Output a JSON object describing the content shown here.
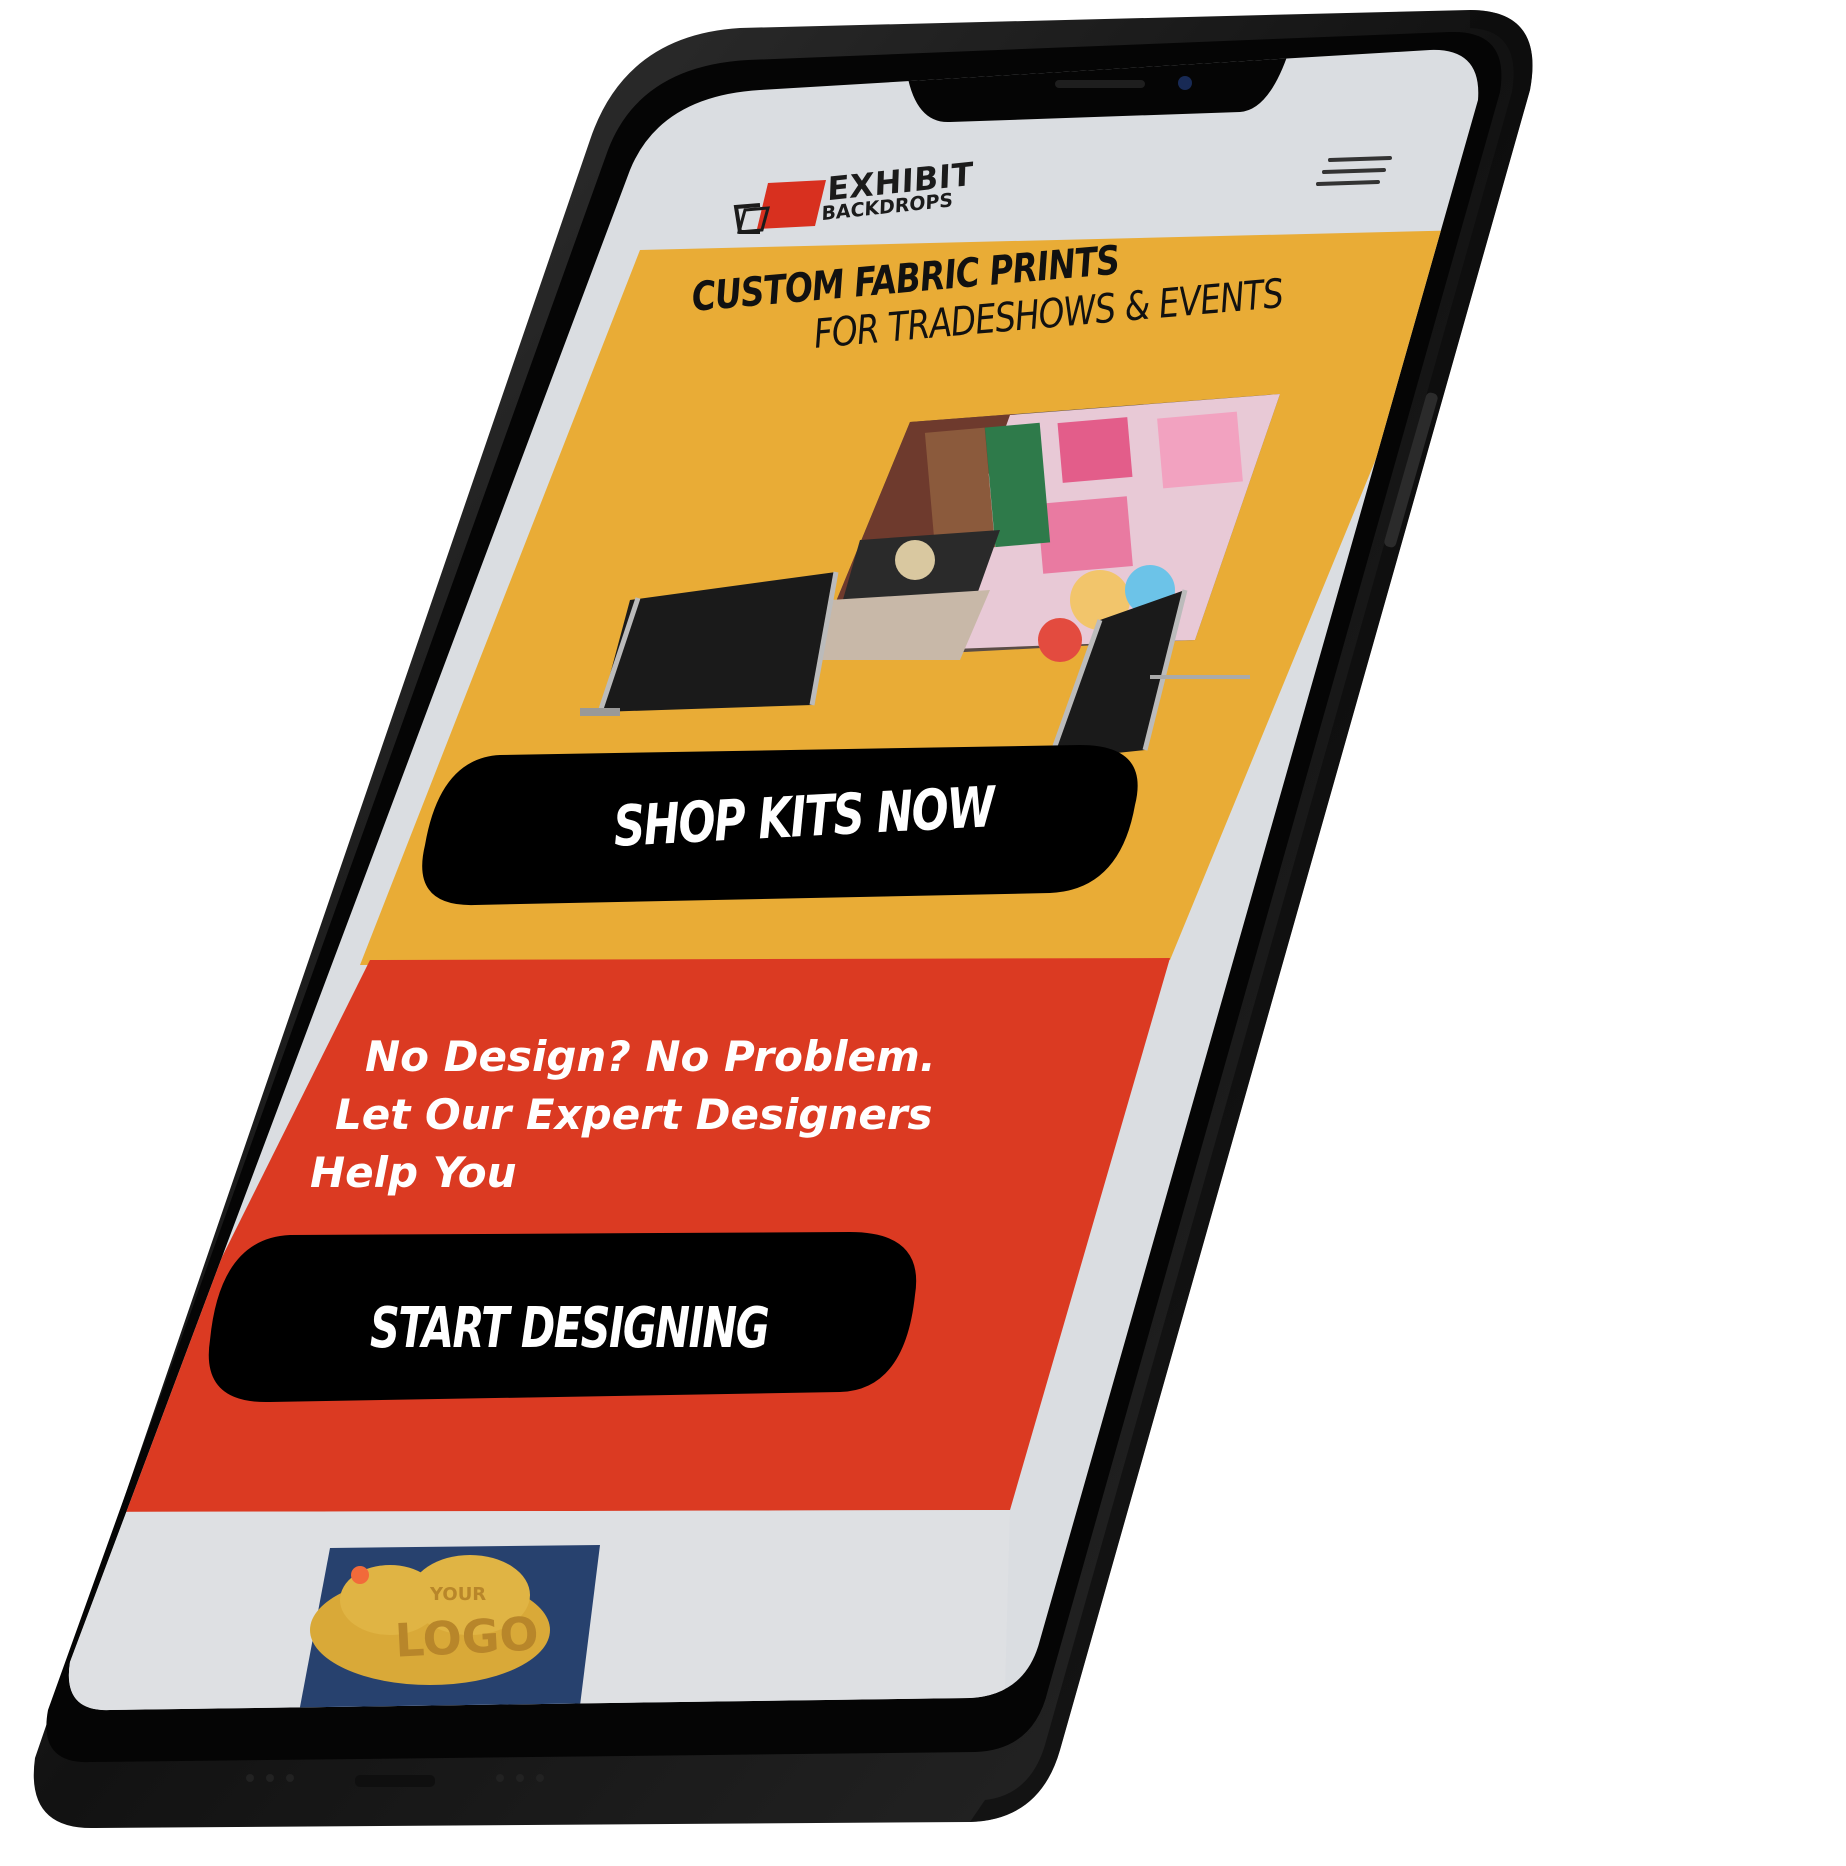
{
  "header": {
    "logo": {
      "line1": "EXHIBIT",
      "line2": "BACKDROPS"
    },
    "menu_icon": "hamburger-menu-icon"
  },
  "hero": {
    "title_line1": "CUSTOM FABRIC PRINTS",
    "title_line2": "FOR TRADESHOWS & EVENTS",
    "image": "product-backdrop-display",
    "cta_label": "SHOP KITS NOW"
  },
  "design_section": {
    "line1": "No Design? No Problem.",
    "line2": "Let Our Expert Designers",
    "line3": "Help You",
    "cta_label": "START DESIGNING"
  },
  "preview": {
    "image": "logo-backdrop-preview",
    "logo_text": "LOGO",
    "your_text": "YOUR"
  },
  "colors": {
    "hero_bg": "#E9AC36",
    "design_bg": "#DB3A22",
    "header_bg": "#DADDE1",
    "button_bg": "#000000",
    "button_text": "#FFFFFF",
    "logo_red": "#D8301F",
    "phone_frame": "#1A1A1A"
  }
}
